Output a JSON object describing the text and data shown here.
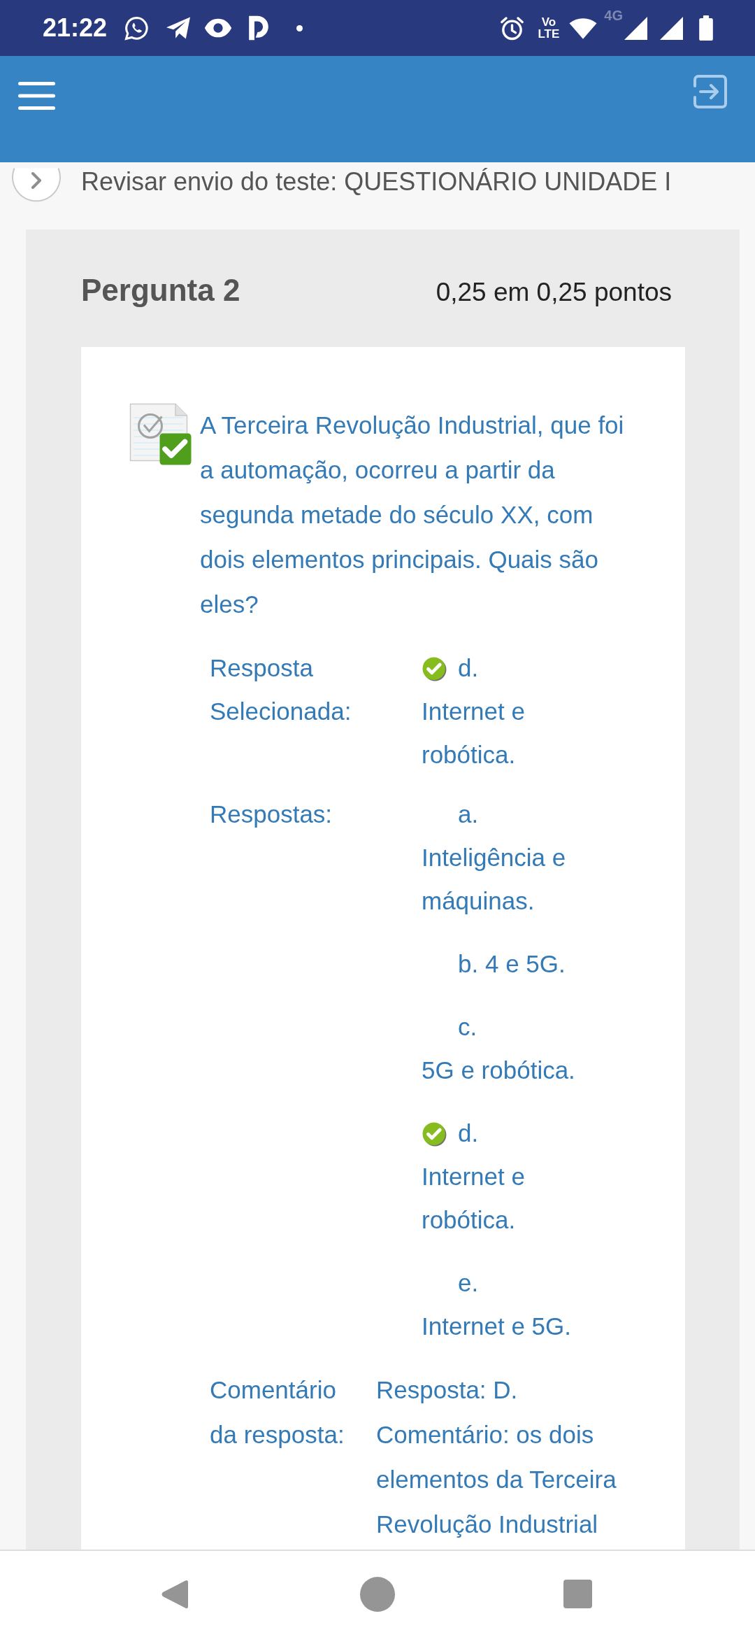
{
  "status_bar": {
    "time": "21:22",
    "volte": [
      "Vo",
      "LTE"
    ],
    "network": "4G"
  },
  "breadcrumb": {
    "title": "Revisar envio do teste: QUESTIONÁRIO UNIDADE I"
  },
  "question": {
    "title": "Pergunta 2",
    "score": "0,25 em 0,25 pontos",
    "correct": true,
    "text": "A Terceira Revolução Industrial, que foi a automação, ocorreu a partir da segunda metade do século XX, com dois elementos principais. Quais são eles?"
  },
  "selected_answer": {
    "label": "Resposta Selecionada:",
    "letter": "d.",
    "text": "Internet e robótica.",
    "correct": true
  },
  "answers": {
    "label": "Respostas:",
    "items": [
      {
        "letter": "a.",
        "text": "Inteligência e máquinas.",
        "correct": false
      },
      {
        "letter": "b.",
        "text": "4 e 5G.",
        "correct": false
      },
      {
        "letter": "c.",
        "text": "5G e robótica.",
        "correct": false
      },
      {
        "letter": "d.",
        "text": "Internet e robótica.",
        "correct": true
      },
      {
        "letter": "e.",
        "text": "Internet e 5G.",
        "correct": false
      }
    ]
  },
  "feedback": {
    "label": "Comentário da resposta:",
    "lines": [
      "Resposta: D.",
      "Comentário: os dois elementos da Terceira Revolução Industrial"
    ]
  }
}
